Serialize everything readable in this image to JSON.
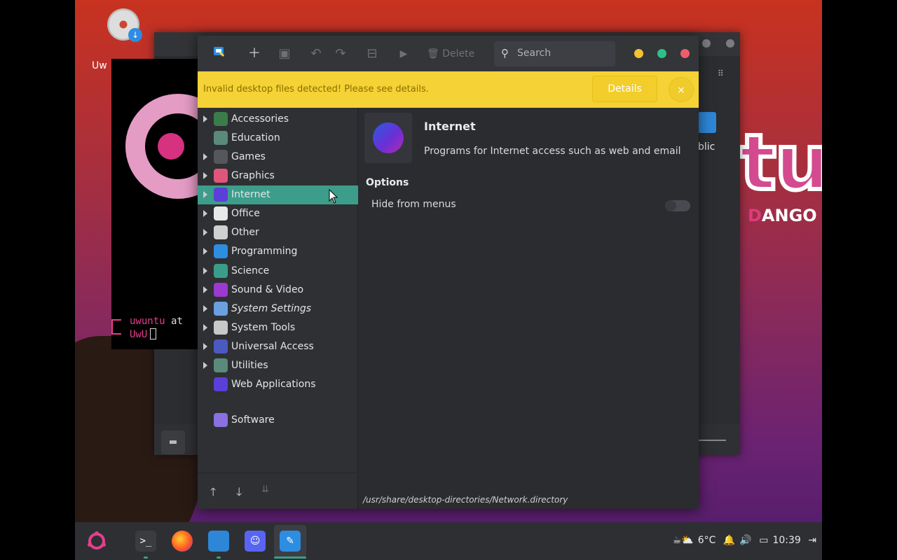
{
  "desktop": {
    "icon_label": "Uw",
    "brand_text": "tu",
    "brand_sub_prefix": "",
    "brand_sub_highlight": "D",
    "brand_sub_rest": "ANGO",
    "bg_window_folder_label": "blic"
  },
  "terminal": {
    "user": "uwuntu",
    "at": "at",
    "host": "UwU"
  },
  "toolbar": {
    "delete_label": "Delete",
    "search_placeholder": "Search"
  },
  "infobar": {
    "message": "Invalid desktop files detected! Please see details.",
    "details_label": "Details",
    "close_label": "×"
  },
  "categories": [
    {
      "label": "Accessories",
      "has_children": true,
      "icon": "accessories-icon",
      "color": "#3a7d4a"
    },
    {
      "label": "Education",
      "has_children": false,
      "icon": "education-icon",
      "color": "#5a8a7a"
    },
    {
      "label": "Games",
      "has_children": true,
      "icon": "games-icon",
      "color": "#55575c"
    },
    {
      "label": "Graphics",
      "has_children": true,
      "icon": "graphics-icon",
      "color": "#e0567a"
    },
    {
      "label": "Internet",
      "has_children": true,
      "icon": "internet-icon",
      "color": "#5a3fd8",
      "selected": true
    },
    {
      "label": "Office",
      "has_children": true,
      "icon": "office-icon",
      "color": "#e8e8e8"
    },
    {
      "label": "Other",
      "has_children": true,
      "icon": "other-icon",
      "color": "#d0d0d0"
    },
    {
      "label": "Programming",
      "has_children": true,
      "icon": "programming-icon",
      "color": "#2d8de0"
    },
    {
      "label": "Science",
      "has_children": true,
      "icon": "science-icon",
      "color": "#3a9d8a"
    },
    {
      "label": "Sound & Video",
      "has_children": true,
      "icon": "sound-video-icon",
      "color": "#9a3ad0"
    },
    {
      "label": "System Settings",
      "has_children": true,
      "icon": "system-settings-icon",
      "color": "#6aa0e0",
      "italic": true
    },
    {
      "label": "System Tools",
      "has_children": true,
      "icon": "system-tools-icon",
      "color": "#c8c8c8"
    },
    {
      "label": "Universal Access",
      "has_children": true,
      "icon": "universal-access-icon",
      "color": "#4a5ac0"
    },
    {
      "label": "Utilities",
      "has_children": true,
      "icon": "utilities-icon",
      "color": "#5a8a7a"
    },
    {
      "label": "Web Applications",
      "has_children": false,
      "icon": "web-applications-icon",
      "color": "#5a3fd8"
    },
    {
      "label": "Software",
      "has_children": false,
      "icon": "software-icon",
      "color": "#8a70e0"
    }
  ],
  "detail": {
    "title": "Internet",
    "description": "Programs for Internet access such as web and email",
    "options_heading": "Options",
    "hide_label": "Hide from menus",
    "hide_enabled": false,
    "path": "/usr/share/desktop-directories/Network.directory"
  },
  "taskbar": {
    "apps": [
      "ubuntu-menu-icon",
      "terminal-icon",
      "firefox-icon",
      "files-icon",
      "discord-icon",
      "menu-editor-icon"
    ],
    "temperature": "6°C",
    "time": "10:39"
  }
}
